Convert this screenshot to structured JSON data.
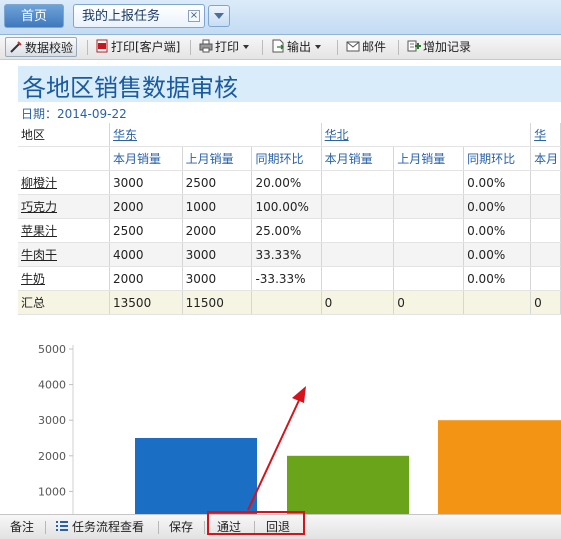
{
  "tabs": {
    "home": "首页",
    "task": "我的上报任务",
    "close": "×"
  },
  "toolbar": {
    "validate": "数据校验",
    "print_client": "打印[客户端]",
    "print": "打印",
    "export": "输出",
    "mail": "邮件",
    "add_record": "增加记录"
  },
  "report": {
    "title": "各地区销售数据审核",
    "date": "日期：2014-09-22",
    "region_label": "地区",
    "regions": [
      "华东",
      "华北",
      "华"
    ],
    "sub_headers": [
      "本月销量",
      "上月销量",
      "同期环比",
      "本月销量",
      "上月销量",
      "同期环比",
      "本月"
    ],
    "rows": [
      {
        "name": "柳橙汁",
        "cells": [
          "3000",
          "2500",
          "20.00%",
          "",
          "",
          "0.00%",
          ""
        ]
      },
      {
        "name": "巧克力",
        "cells": [
          "2000",
          "1000",
          "100.00%",
          "",
          "",
          "0.00%",
          ""
        ]
      },
      {
        "name": "苹果汁",
        "cells": [
          "2500",
          "2000",
          "25.00%",
          "",
          "",
          "0.00%",
          ""
        ]
      },
      {
        "name": "牛肉干",
        "cells": [
          "4000",
          "3000",
          "33.33%",
          "",
          "",
          "0.00%",
          ""
        ]
      },
      {
        "name": "牛奶",
        "cells": [
          "2000",
          "3000",
          "-33.33%",
          "",
          "",
          "0.00%",
          ""
        ]
      }
    ],
    "total": {
      "name": "汇总",
      "cells": [
        "13500",
        "11500",
        "",
        "0",
        "0",
        "",
        "0"
      ]
    }
  },
  "chart_data": {
    "type": "bar",
    "y_ticks": [
      1000,
      2000,
      3000,
      4000,
      5000
    ],
    "ylim": [
      0,
      5000
    ],
    "values": [
      2500,
      2000,
      3000
    ],
    "colors": [
      "#1a6fc4",
      "#6aa41a",
      "#f39415"
    ]
  },
  "bottombar": {
    "note": "备注",
    "flow": "任务流程查看",
    "save": "保存",
    "approve": "通过",
    "reject": "回退"
  },
  "colors": {
    "highlight": "#d8121b",
    "title_bg": "#d8ecfa",
    "accent": "#1a5aa0"
  }
}
